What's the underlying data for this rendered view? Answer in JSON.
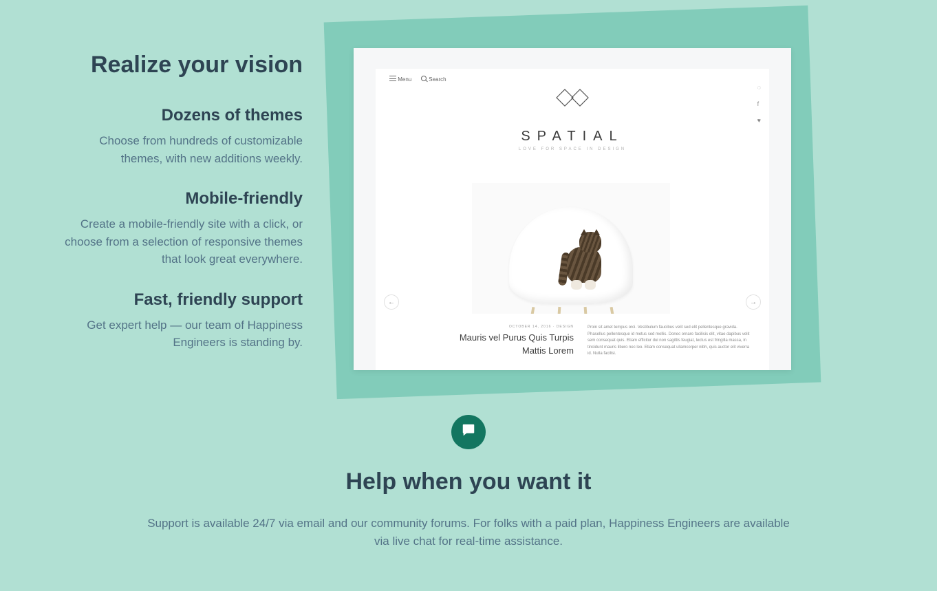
{
  "vision": {
    "title": "Realize your vision",
    "features": [
      {
        "title": "Dozens of themes",
        "body": "Choose from hundreds of customizable themes, with new additions weekly."
      },
      {
        "title": "Mobile-friendly",
        "body": "Create a mobile-friendly site with a click, or choose from a selection of responsive themes that look great everywhere."
      },
      {
        "title": "Fast, friendly support",
        "body": "Get expert help — our team of Happiness Engineers is standing by."
      }
    ]
  },
  "preview": {
    "menu_label": "Menu",
    "search_label": "Search",
    "brand": "SPATIAL",
    "tagline": "LOVE FOR SPACE IN DESIGN",
    "prev_arrow": "←",
    "next_arrow": "→",
    "article_meta": "OCTOBER 14, 2016 · DESIGN",
    "article_title": "Mauris vel Purus Quis Turpis Mattis Lorem",
    "article_body": "Proin sit amet tempus orci. Vestibulum faucibus velit sed elit pellentesque gravida. Phasellus pellentesque id metus sed mollis. Donec ornare facilisis elit, vitae dapibus velit sem consequat quis. Etiam efficitur dui non sagittis feugiat, lectus est fringilla massa, in tincidunt mauris libero nec leo. Etiam consequat ullamcorper nibh, quis auctor elit viverra id. Nulla facilisi."
  },
  "help": {
    "title": "Help when you want it",
    "body": "Support is available 24/7 via email and our community forums. For folks with a paid plan, Happiness Engineers are available via live chat for real-time assistance."
  },
  "colors": {
    "page_bg": "#b1e0d3",
    "accent_bg": "#82ccba",
    "badge": "#137660",
    "heading": "#2e4453",
    "body_text": "#537387"
  }
}
